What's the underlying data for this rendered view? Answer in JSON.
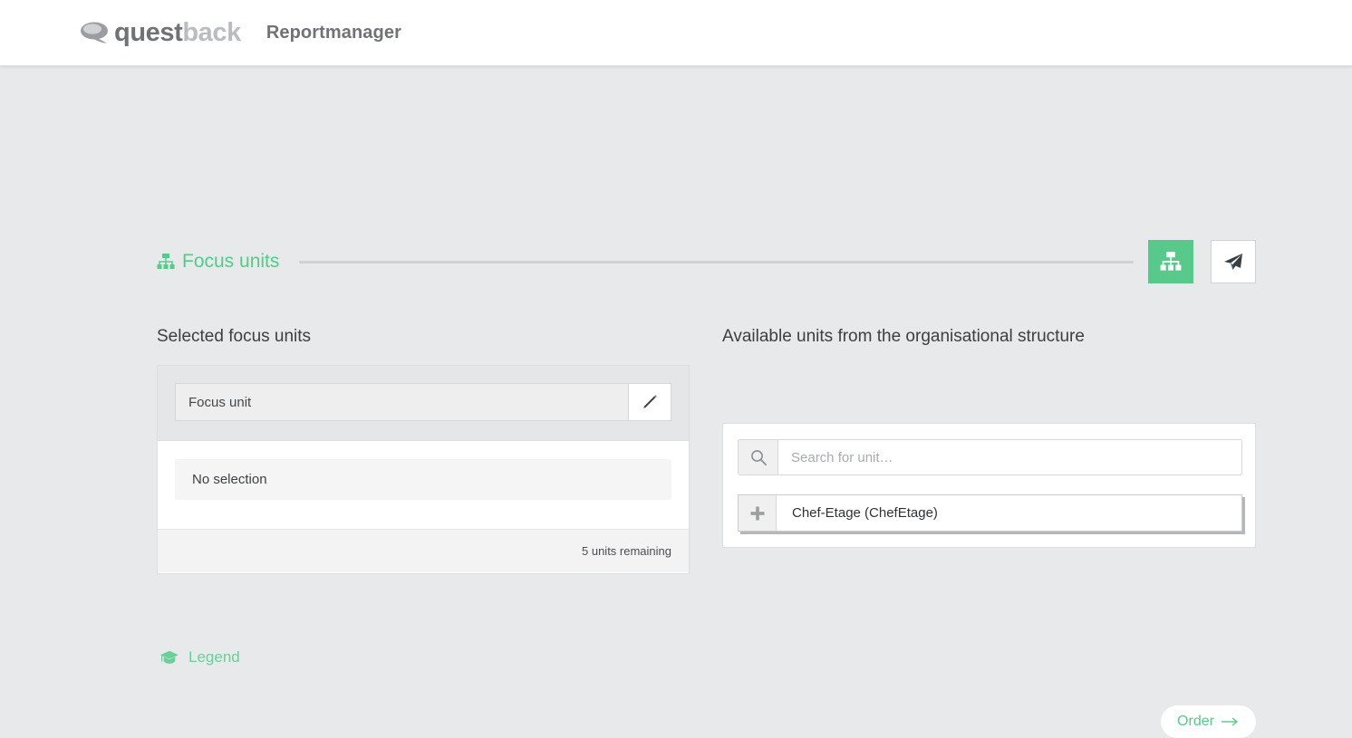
{
  "topbar": {
    "logo_word_1": "quest",
    "logo_word_2": "back",
    "logo_icon": "speech-bubble-icon",
    "app_title": "Reportmanager"
  },
  "section": {
    "icon": "sitemap-icon",
    "title": "Focus units",
    "buttons": [
      {
        "name": "sitemap-view-button",
        "icon": "sitemap-icon",
        "state": "active"
      },
      {
        "name": "send-button",
        "icon": "paper-plane-icon",
        "state": "default"
      }
    ]
  },
  "left_panel": {
    "heading": "Selected focus units",
    "focus_unit_label": "Focus unit",
    "edit_icon": "pencil-icon",
    "no_selection": "No selection",
    "units_remaining": "5 units remaining"
  },
  "legend": {
    "icon": "graduation-cap-icon",
    "label": "Legend"
  },
  "right_panel": {
    "heading": "Available units from the organisational structure",
    "search": {
      "icon": "search-icon",
      "value": "",
      "placeholder": "Search for unit…"
    },
    "tree": [
      {
        "expand_icon": "plus-icon",
        "label": "Chef-Etage (ChefEtage)"
      }
    ]
  },
  "footer": {
    "order_label": "Order",
    "order_arrow": "→"
  },
  "colors": {
    "accent_green": "#57c98b",
    "page_background": "#e7e9ea",
    "panel_background": "#ffffff",
    "text_dark": "#3c4042",
    "text_muted": "#a7abae"
  }
}
